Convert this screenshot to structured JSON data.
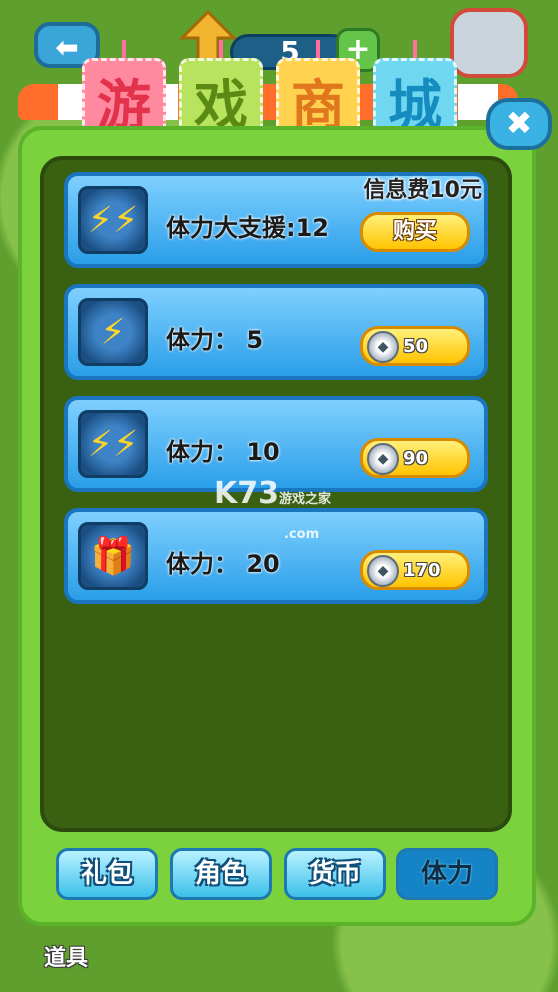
{
  "top": {
    "back_symbol": "⬅",
    "level_value": "5",
    "plus_symbol": "+"
  },
  "title_chars": [
    "游",
    "戏",
    "商",
    "城"
  ],
  "close_symbol": "✖",
  "items": [
    {
      "icon": "double-lightning-icon",
      "label": "体力大支援:12",
      "fee_text": "信息费10元",
      "buy_label": "购买"
    },
    {
      "icon": "lightning-icon",
      "label": "体力： 5",
      "price": "50"
    },
    {
      "icon": "double-lightning-icon",
      "label": "体力： 10",
      "price": "90"
    },
    {
      "icon": "gift-lightning-icon",
      "label": "体力： 20",
      "price": "170"
    }
  ],
  "watermark": {
    "main": "K73",
    "sub": "游戏之家",
    "domain": ".com"
  },
  "tabs": [
    {
      "label": "礼包",
      "active": false
    },
    {
      "label": "角色",
      "active": false
    },
    {
      "label": "货币",
      "active": false
    },
    {
      "label": "体力",
      "active": true
    }
  ],
  "bottom_label": "道具"
}
